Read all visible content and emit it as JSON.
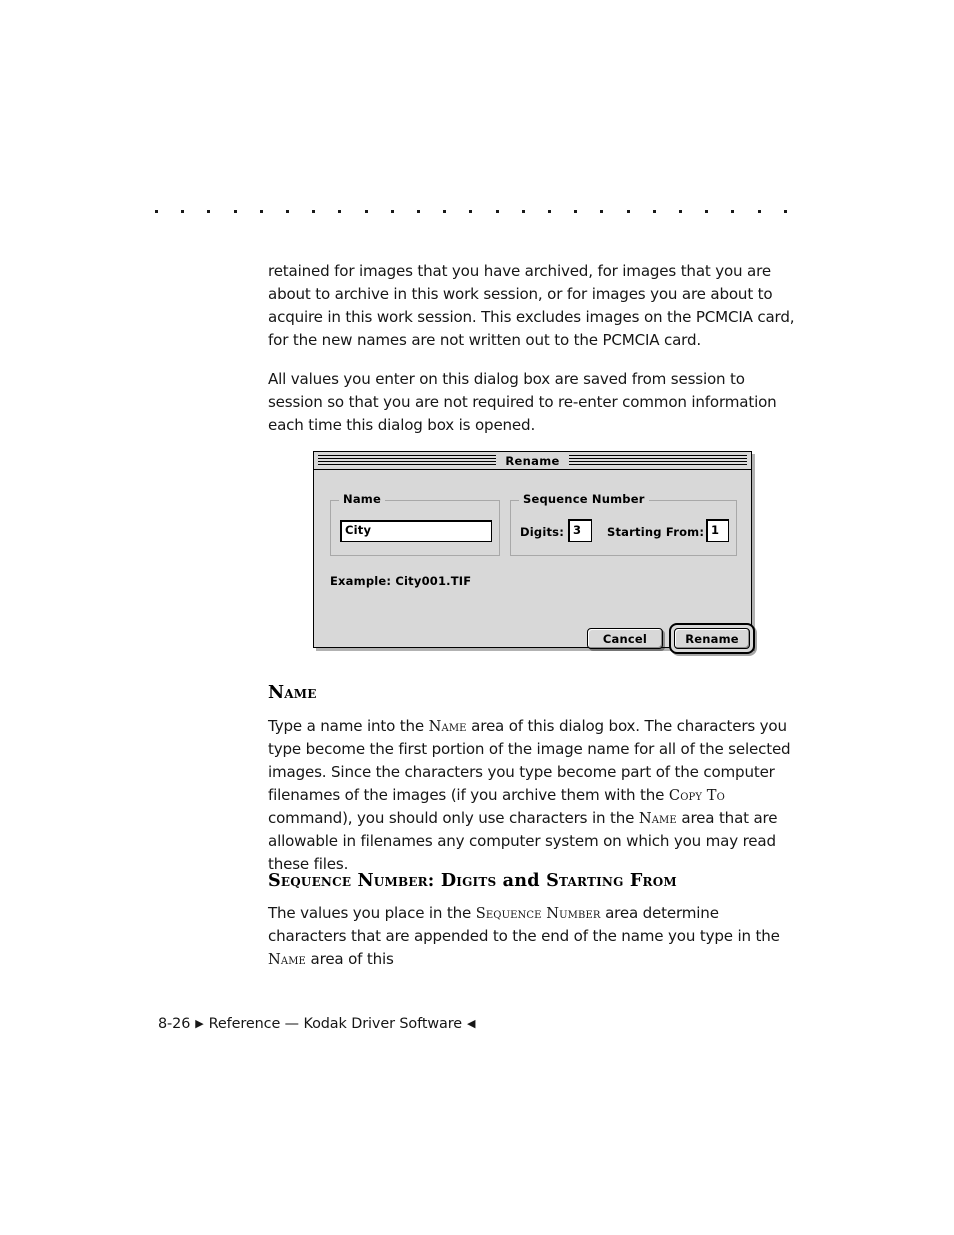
{
  "page": {
    "rule_dot_count": 25
  },
  "body": {
    "paragraph_1_part_1": "retained for images that you have archived, for images that you are about to archive in this work session, or for images you are about to acquire in this work session. This excludes images on the PCMCIA card, for the new names are not written out to the PCMCIA card.",
    "paragraph_2": "All values you enter on this dialog box are saved from session to session so that you are not required to re-enter common information each time this dialog box is opened."
  },
  "sections": [
    {
      "heading": "Name",
      "para_before_sc1": "Type a name into the ",
      "sc1": "Name",
      "para_mid_1": " area of this dialog box. The characters you type become the first portion of the image name for all of the selected images. Since the characters you type become part of the computer filenames of the images (if you archive them with the ",
      "sc2": "Copy To",
      "para_mid_2": " command), you should only use characters in the ",
      "sc3": "Name",
      "para_end": " area that are allowable in filenames any computer system on which you may read these files."
    },
    {
      "heading_part_1": "Sequence Number: Digits",
      "heading_and": " and ",
      "heading_part_2": "Starting From",
      "para_start": "The values you place in the ",
      "sc1": "Sequence Number",
      "para_mid": " area determine characters that are appended to the end of the name you type in the ",
      "sc2": "Name",
      "para_end": " area of this"
    }
  ],
  "dialog": {
    "title": "Rename",
    "name_group": {
      "label": "Name",
      "field_value": "City"
    },
    "sequence_group": {
      "label": "Sequence Number",
      "digits_label": "Digits:",
      "digits_value": "3",
      "starting_from_label": "Starting From:",
      "starting_from_value": "1"
    },
    "example_text": "Example: City001.TIF",
    "cancel_label": "Cancel",
    "rename_label": "Rename"
  },
  "footer": {
    "page_number": "8-26",
    "marker_left": "▶",
    "text": "Reference — Kodak Driver Software",
    "marker_right": "◀"
  }
}
